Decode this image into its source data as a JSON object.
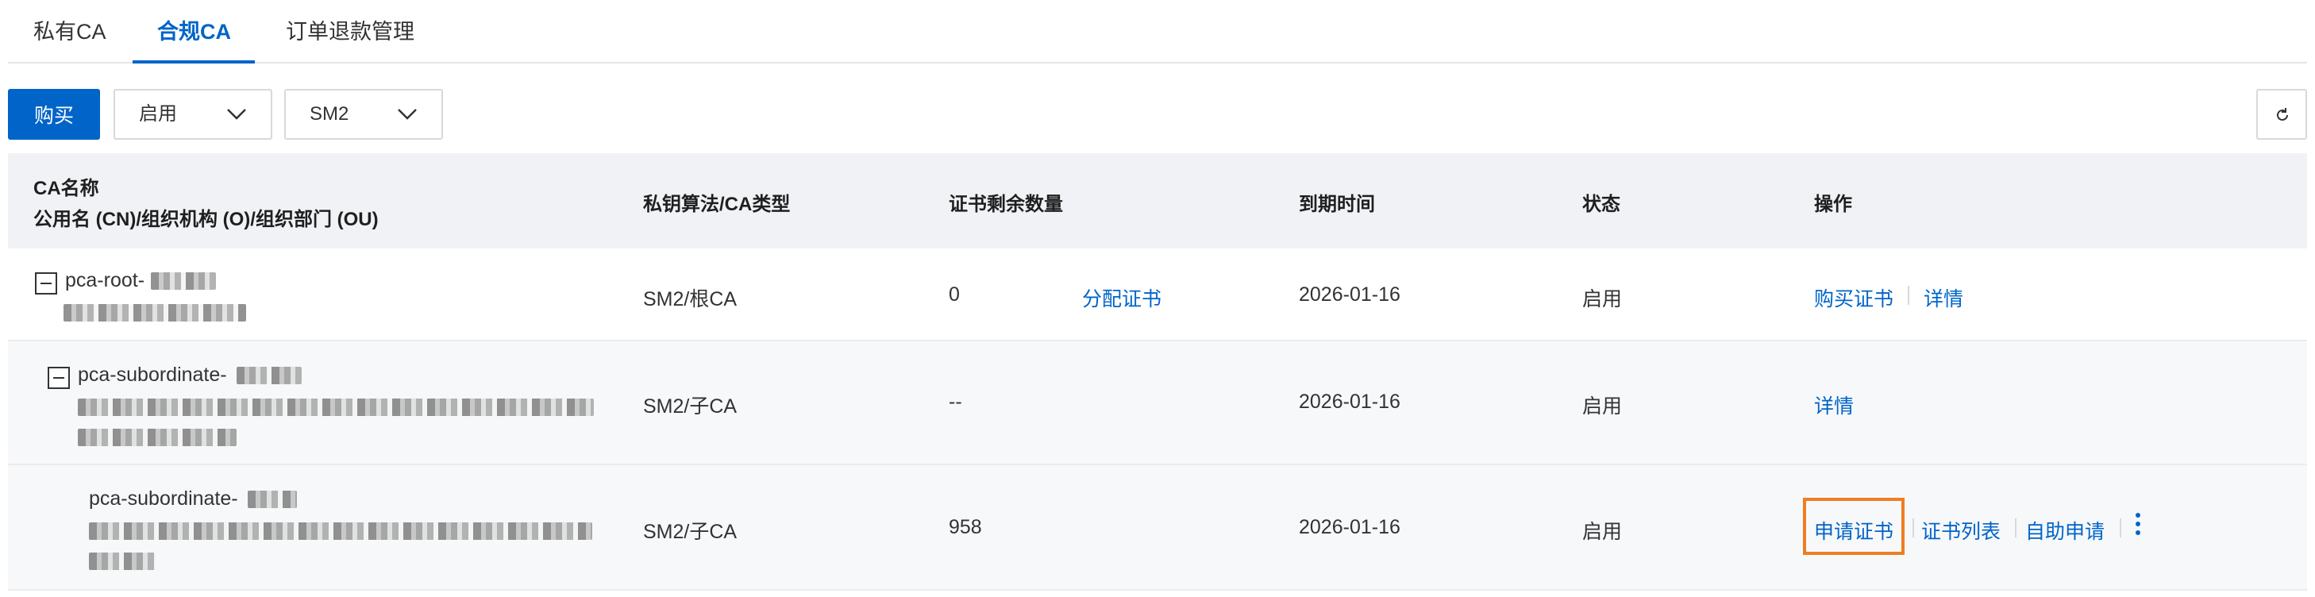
{
  "tabs": [
    {
      "label": "私有CA",
      "active": false
    },
    {
      "label": "合规CA",
      "active": true
    },
    {
      "label": "订单退款管理",
      "active": false
    }
  ],
  "toolbar": {
    "buy_label": "购买",
    "status_select": "启用",
    "algo_select": "SM2"
  },
  "table": {
    "headers": {
      "name_line1": "CA名称",
      "name_line2": "公用名 (CN)/组织机构 (O)/组织部门 (OU)",
      "algo": "私钥算法/CA类型",
      "remaining": "证书剩余数量",
      "expiry": "到期时间",
      "status": "状态",
      "actions": "操作"
    },
    "rows": [
      {
        "name": "pca-root-",
        "algo": "SM2/根CA",
        "remaining": "0",
        "allocate": "分配证书",
        "expiry": "2026-01-16",
        "status": "启用",
        "actions": [
          "购买证书",
          "详情"
        ]
      },
      {
        "name": "pca-subordinate-",
        "algo": "SM2/子CA",
        "remaining": "--",
        "expiry": "2026-01-16",
        "status": "启用",
        "actions": [
          "详情"
        ]
      },
      {
        "name": "pca-subordinate-",
        "algo": "SM2/子CA",
        "remaining": "958",
        "expiry": "2026-01-16",
        "status": "启用",
        "actions": [
          "申请证书",
          "证书列表",
          "自助申请"
        ]
      }
    ]
  },
  "colors": {
    "accent": "#0064c8",
    "highlight": "#ef7d22"
  }
}
